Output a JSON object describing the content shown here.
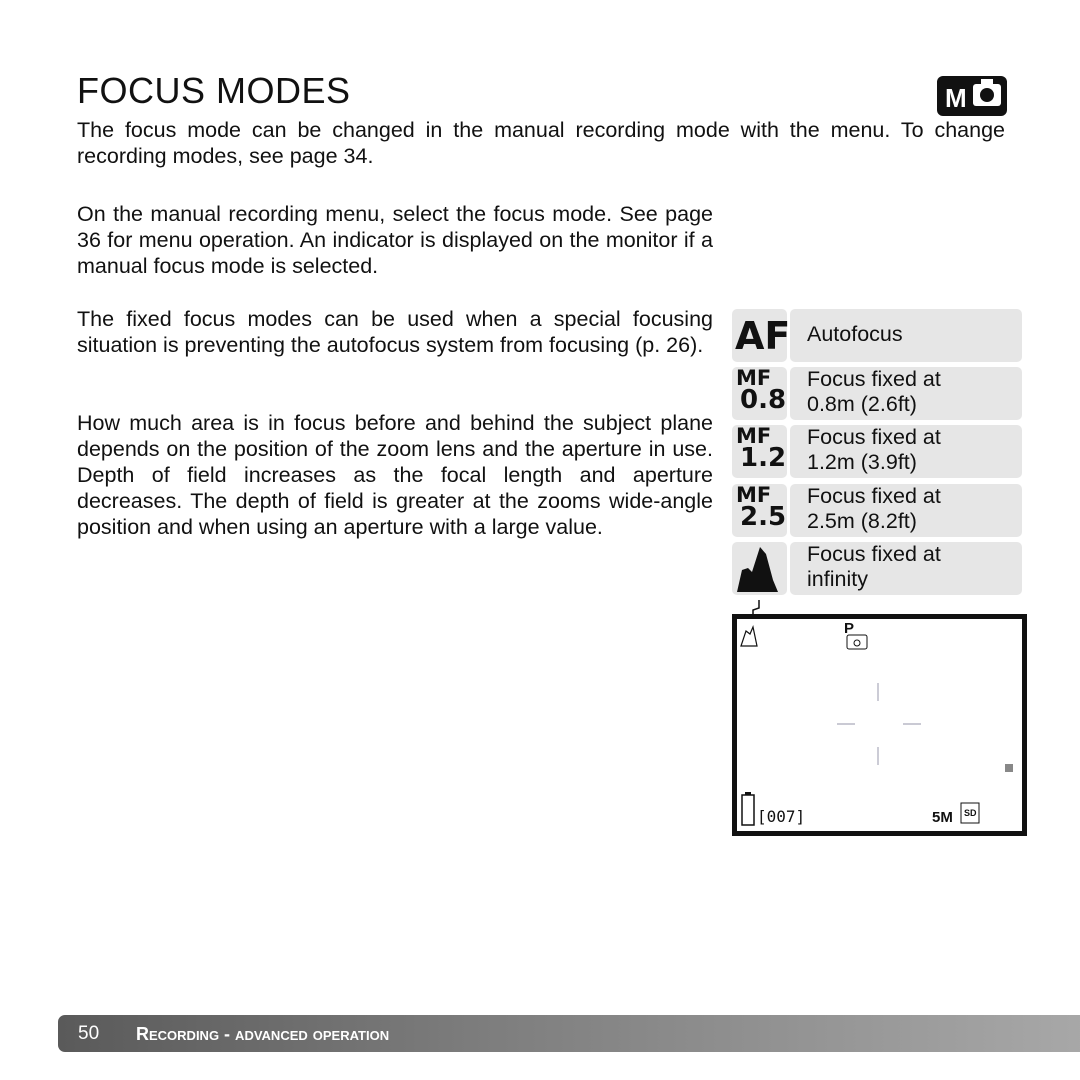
{
  "title": "FOCUS MODES",
  "mode_badge": {
    "letter": "M",
    "icon": "camera-icon"
  },
  "paragraphs": [
    "The focus mode can be changed in the manual recording mode with the menu. To change recording modes, see page 34.",
    "On the manual recording menu, select the focus mode. See page 36 for menu operation. An indicator is displayed on the monitor if a manual focus mode is selected.",
    "The fixed focus modes can be used when a special focusing situation is preventing the autofocus system from focusing (p. 26).",
    "How much area is in focus before and behind the subject plane depends on the position of the zoom lens and the aperture in use. Depth of field increases as the focal length and aperture decreases. The depth of field is greater at the zooms wide-angle position and when using an aperture with a large value."
  ],
  "focus_modes": [
    {
      "icon_top": "AF",
      "icon_bottom": "",
      "line1": "Autofocus",
      "line2": ""
    },
    {
      "icon_top": "MF",
      "icon_bottom": "0.8",
      "line1": "Focus fixed at",
      "line2": "0.8m (2.6ft)"
    },
    {
      "icon_top": "MF",
      "icon_bottom": "1.2",
      "line1": "Focus fixed at",
      "line2": "1.2m (3.9ft)"
    },
    {
      "icon_top": "MF",
      "icon_bottom": "2.5",
      "line1": "Focus fixed at",
      "line2": "2.5m (8.2ft)"
    },
    {
      "icon_top": "",
      "icon_bottom": "",
      "icon": "mountain-icon",
      "line1": "Focus fixed at",
      "line2": "infinity"
    }
  ],
  "monitor": {
    "frame_count": "[007]",
    "resolution": "5M",
    "card": "SD",
    "program_mode": "P"
  },
  "footer": {
    "page_number": "50",
    "section": "Recording - advanced operation"
  }
}
